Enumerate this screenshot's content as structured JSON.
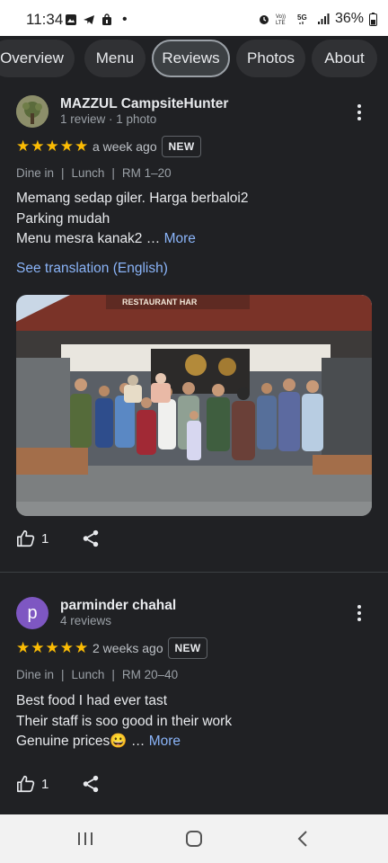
{
  "status_bar": {
    "time": "11:34",
    "dot": "•",
    "battery": "36%",
    "icons": [
      "photo-icon",
      "telegram-icon",
      "bag-icon",
      "alarm-icon",
      "volte-icon",
      "5g-icon",
      "signal-icon",
      "battery-icon"
    ]
  },
  "tabs": [
    {
      "label": "Overview",
      "active": false
    },
    {
      "label": "Menu",
      "active": false
    },
    {
      "label": "Reviews",
      "active": true
    },
    {
      "label": "Photos",
      "active": false
    },
    {
      "label": "About",
      "active": false
    }
  ],
  "reviews": [
    {
      "author": "MAZZUL CampsiteHunter",
      "meta": "1 review · 1 photo",
      "rating": 5,
      "when": "a week ago",
      "badge": "NEW",
      "dine": [
        "Dine in",
        "|",
        "Lunch",
        "|",
        "RM 1–20"
      ],
      "lines": [
        "Memang sedap giler. Harga berbaloi2",
        "Parking mudah",
        "Menu mesra kanak2 …"
      ],
      "more": "More",
      "translate": "See translation (English)",
      "photo_sign": "RESTAURANT HAR",
      "likes": "1"
    },
    {
      "author": "parminder chahal",
      "initial": "p",
      "meta": "4 reviews",
      "rating": 5,
      "when": "2 weeks ago",
      "badge": "NEW",
      "dine": [
        "Dine in",
        "|",
        "Lunch",
        "|",
        "RM 20–40"
      ],
      "lines": [
        "Best food I had ever tast",
        "Their staff is soo good in their work",
        "Genuine prices😀 …"
      ],
      "more": "More",
      "likes": "1"
    }
  ],
  "colors": {
    "background": "#202124",
    "link": "#8ab4f8",
    "star": "#fbbc04",
    "avatar_p": "#7e57c2"
  }
}
